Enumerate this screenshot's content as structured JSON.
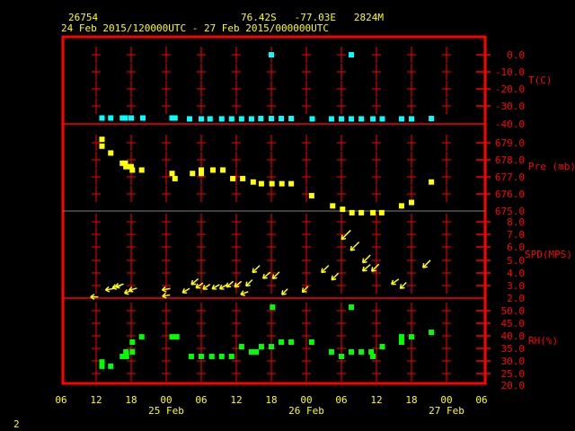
{
  "header": {
    "station": "26754",
    "location": "76.42S   -77.03E   2824M",
    "period": "24 Feb 2015/120000UTC - 27 Feb 2015/000000UTC"
  },
  "footer": {
    "page": "2"
  },
  "chart_data": [
    {
      "type": "scatter",
      "title": "Temperature",
      "ylabel": "T(C)",
      "ylim": [
        -40,
        0
      ],
      "yticks": [
        "0.0",
        "-10.0",
        "-20.0",
        "-30.0",
        "-40.0"
      ],
      "color": "#00ffff",
      "time_unit": "hours since 24 Feb 06UTC",
      "points": [
        [
          7,
          -36.5
        ],
        [
          8.5,
          -36.5
        ],
        [
          10.5,
          -36.5
        ],
        [
          11,
          -36.5
        ],
        [
          12,
          -36.5
        ],
        [
          14,
          -36.5
        ],
        [
          19,
          -36.5
        ],
        [
          19.5,
          -36.5
        ],
        [
          22,
          -37
        ],
        [
          24,
          -37
        ],
        [
          25.5,
          -37
        ],
        [
          27.5,
          -37
        ],
        [
          29.2,
          -37
        ],
        [
          30.9,
          -37
        ],
        [
          32.6,
          -37
        ],
        [
          34.2,
          -36.8
        ],
        [
          36,
          -36.8
        ],
        [
          37.7,
          -36.8
        ],
        [
          39.4,
          -36.8
        ],
        [
          43,
          -37
        ],
        [
          46.3,
          -37
        ],
        [
          48,
          -37
        ],
        [
          49.7,
          -37
        ],
        [
          51.4,
          -37
        ],
        [
          53.4,
          -37
        ],
        [
          55,
          -37
        ],
        [
          58.3,
          -37
        ],
        [
          60,
          -37
        ],
        [
          63.4,
          -36.8
        ],
        [
          36,
          0
        ],
        [
          49.7,
          0
        ]
      ]
    },
    {
      "type": "scatter",
      "title": "Pressure",
      "ylabel": "Pre (mb)",
      "ylim": [
        674.9,
        679.4
      ],
      "yticks": [
        "679.0",
        "678.0",
        "677.0",
        "676.0",
        "675.0"
      ],
      "color": "#ffff00",
      "time_unit": "hours since 24 Feb 06UTC",
      "points": [
        [
          7,
          679.2
        ],
        [
          7,
          678.8
        ],
        [
          8.5,
          678.4
        ],
        [
          10.5,
          677.8
        ],
        [
          11,
          677.8
        ],
        [
          11.1,
          677.6
        ],
        [
          12,
          677.6
        ],
        [
          12.2,
          677.4
        ],
        [
          13.8,
          677.4
        ],
        [
          19,
          677.2
        ],
        [
          19.5,
          676.9
        ],
        [
          22.5,
          677.2
        ],
        [
          24,
          677.4
        ],
        [
          24,
          677.2
        ],
        [
          26,
          677.4
        ],
        [
          27.7,
          677.4
        ],
        [
          29.4,
          676.9
        ],
        [
          31.1,
          676.9
        ],
        [
          32.9,
          676.7
        ],
        [
          34.3,
          676.6
        ],
        [
          36.1,
          676.6
        ],
        [
          37.8,
          676.6
        ],
        [
          39.4,
          676.6
        ],
        [
          42.9,
          675.9
        ],
        [
          46.5,
          675.3
        ],
        [
          48.2,
          675.1
        ],
        [
          49.8,
          674.9
        ],
        [
          51.4,
          674.9
        ],
        [
          53.4,
          674.9
        ],
        [
          54.9,
          674.9
        ],
        [
          58.3,
          675.3
        ],
        [
          60,
          675.5
        ],
        [
          63.4,
          676.7
        ]
      ]
    },
    {
      "type": "vector",
      "title": "Wind",
      "ylabel": "SPD(MPS)",
      "ylim": [
        2,
        8
      ],
      "yticks": [
        "8.0",
        "7.0",
        "6.0",
        "5.0",
        "4.0",
        "3.0",
        "2.0"
      ],
      "color": "#ffff00",
      "time_unit": "hours since 24 Feb 06UTC",
      "points": [
        [
          5.7,
          2.1,
          90
        ],
        [
          8.3,
          2.7,
          80
        ],
        [
          9.5,
          2.9,
          75
        ],
        [
          10,
          3.0,
          70
        ],
        [
          11.5,
          2.5,
          70
        ],
        [
          12.3,
          2.7,
          75
        ],
        [
          18,
          2.7,
          80
        ],
        [
          18,
          2.2,
          80
        ],
        [
          21.4,
          2.6,
          60
        ],
        [
          22.9,
          3.3,
          50
        ],
        [
          23.7,
          3.0,
          55
        ],
        [
          24.9,
          2.9,
          55
        ],
        [
          26.5,
          2.9,
          60
        ],
        [
          27.8,
          2.9,
          60
        ],
        [
          28.9,
          3.1,
          50
        ],
        [
          30.3,
          3.1,
          50
        ],
        [
          31.4,
          2.4,
          70
        ],
        [
          32.2,
          3.2,
          45
        ],
        [
          33.4,
          4.3,
          45
        ],
        [
          35.2,
          3.8,
          50
        ],
        [
          36.8,
          3.8,
          45
        ],
        [
          38.3,
          2.5,
          45
        ],
        [
          41.8,
          2.7,
          45
        ],
        [
          45.2,
          4.3,
          45
        ],
        [
          46.9,
          3.7,
          45
        ],
        [
          48.8,
          7.0,
          45
        ],
        [
          50.3,
          6.1,
          45
        ],
        [
          52.3,
          5.1,
          45
        ],
        [
          52.3,
          4.4,
          50
        ],
        [
          53.8,
          4.4,
          45
        ],
        [
          57.2,
          3.3,
          55
        ],
        [
          58.6,
          3.0,
          45
        ],
        [
          62.6,
          4.7,
          45
        ]
      ]
    },
    {
      "type": "scatter",
      "title": "Relative Humidity",
      "ylabel": "RH(%)",
      "ylim": [
        20,
        52
      ],
      "yticks": [
        "50.0",
        "45.0",
        "40.0",
        "35.0",
        "30.0",
        "25.0",
        "20.0"
      ],
      "color": "#00ff00",
      "time_unit": "hours since 24 Feb 06UTC",
      "points": [
        [
          7,
          29.6
        ],
        [
          7,
          27.9
        ],
        [
          8.5,
          27.9
        ],
        [
          10.5,
          31.8
        ],
        [
          11.2,
          31.8
        ],
        [
          11.1,
          33.6
        ],
        [
          12.2,
          33.6
        ],
        [
          12.2,
          37.5
        ],
        [
          13.8,
          39.6
        ],
        [
          19,
          39.6
        ],
        [
          19.8,
          39.6
        ],
        [
          22.3,
          31.8
        ],
        [
          24,
          31.8
        ],
        [
          25.8,
          31.8
        ],
        [
          27.5,
          31.8
        ],
        [
          29.2,
          31.8
        ],
        [
          30.9,
          35.7
        ],
        [
          32.6,
          33.6
        ],
        [
          33.4,
          33.6
        ],
        [
          34.3,
          35.7
        ],
        [
          36,
          35.7
        ],
        [
          36.2,
          51.4
        ],
        [
          37.7,
          37.5
        ],
        [
          39.4,
          37.5
        ],
        [
          42.9,
          37.5
        ],
        [
          46.3,
          33.6
        ],
        [
          48,
          31.8
        ],
        [
          49.7,
          33.6
        ],
        [
          49.7,
          51.4
        ],
        [
          51.4,
          33.6
        ],
        [
          53.1,
          33.6
        ],
        [
          53.4,
          31.8
        ],
        [
          55,
          35.7
        ],
        [
          58.3,
          39.6
        ],
        [
          58.3,
          37.5
        ],
        [
          60,
          39.6
        ],
        [
          63.4,
          41.4
        ]
      ]
    }
  ],
  "xaxis": {
    "ticks": [
      "06",
      "12",
      "18",
      "00",
      "06",
      "12",
      "18",
      "00",
      "06",
      "12",
      "18",
      "00",
      "06"
    ],
    "dates": [
      "25 Feb",
      "26 Feb",
      "27 Feb"
    ]
  }
}
